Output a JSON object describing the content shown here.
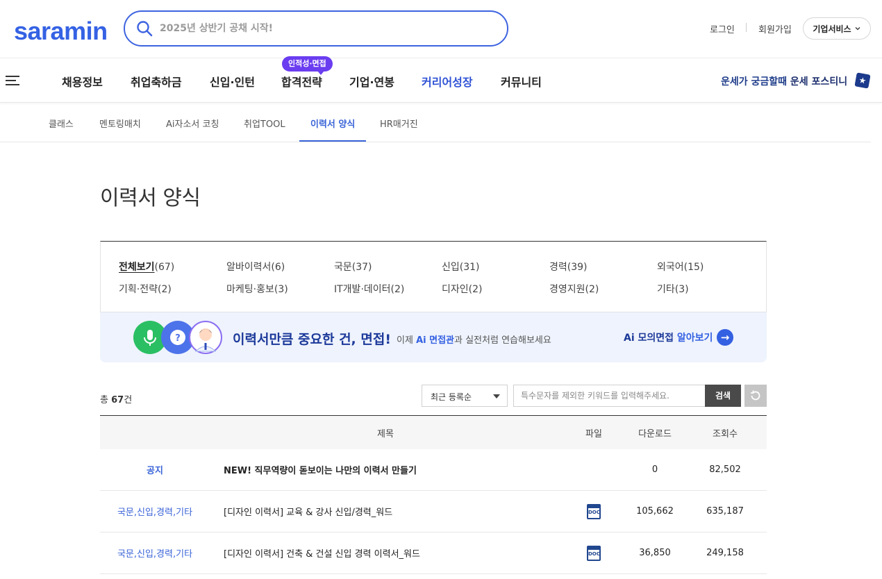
{
  "header": {
    "logo": "saramin",
    "search_placeholder": "2025년 상반기 공채 시작!",
    "login": "로그인",
    "signup": "회원가입",
    "biz_service": "기업서비스",
    "brand_color": "#3562e4"
  },
  "gnb": {
    "items": [
      "채용정보",
      "취업축하금",
      "신입·인턴",
      "합격전략",
      "기업·연봉",
      "커리어성장",
      "커뮤니티"
    ],
    "badge": "인적성·면접",
    "fortune_text": "운세가 궁금할때",
    "fortune_strong": "운세 포스티니"
  },
  "subnav": {
    "items": [
      "클래스",
      "멘토링매치",
      "Ai자소서 코칭",
      "취업TOOL",
      "이력서 양식",
      "HR매거진"
    ],
    "active": "이력서 양식"
  },
  "page": {
    "title": "이력서 양식"
  },
  "categories": [
    {
      "name": "전체보기",
      "count": "(67)"
    },
    {
      "name": "알바이력서",
      "count": "(6)"
    },
    {
      "name": "국문",
      "count": "(37)"
    },
    {
      "name": "신입",
      "count": "(31)"
    },
    {
      "name": "경력",
      "count": "(39)"
    },
    {
      "name": "외국어",
      "count": "(15)"
    },
    {
      "name": "기획·전략",
      "count": "(2)"
    },
    {
      "name": "마케팅·홍보",
      "count": "(3)"
    },
    {
      "name": "IT개발·데이터",
      "count": "(2)"
    },
    {
      "name": "디자인",
      "count": "(2)"
    },
    {
      "name": "경영지원",
      "count": "(2)"
    },
    {
      "name": "기타",
      "count": "(3)"
    }
  ],
  "banner": {
    "headline": "이력서만큼 중요한 건, 면접!",
    "sub_pre": "이제 ",
    "sub_strong": "Ai 면접관",
    "sub_post": "과 실전처럼 연습해보세요",
    "link_strong": "Ai 모의면접",
    "link_rest": " 알아보기"
  },
  "toolbar": {
    "total_pre": "총 ",
    "total_count": "67",
    "total_post": "건",
    "sort_selected": "최근 등록순",
    "keyword_placeholder": "특수문자를 제외한 키워드를 입력해주세요.",
    "search_button": "검색"
  },
  "table": {
    "headers": {
      "title": "제목",
      "file": "파일",
      "downloads": "다운로드",
      "views": "조회수"
    },
    "rows": [
      {
        "category": "공지",
        "title": "NEW! 직무역량이 돋보이는 나만의 이력서 만들기",
        "file": "",
        "downloads": "0",
        "views": "82,502"
      },
      {
        "category": "국문,신입,경력,기타",
        "title": "[디자인 이력서] 교육 & 강사 신입/경력_워드",
        "file": "DOC",
        "downloads": "105,662",
        "views": "635,187"
      },
      {
        "category": "국문,신입,경력,기타",
        "title": "[디자인 이력서] 건축 & 건설 신입 경력 이력서_워드",
        "file": "DOC",
        "downloads": "36,850",
        "views": "249,158"
      }
    ]
  }
}
